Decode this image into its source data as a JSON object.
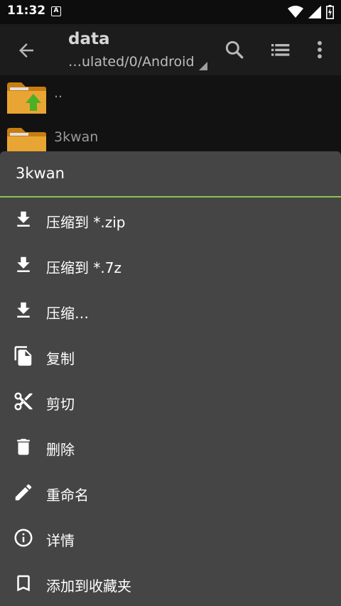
{
  "status_bar": {
    "time": "11:32",
    "notification_letter": "A"
  },
  "app_bar": {
    "title": "data",
    "subtitle": "…ulated/0/Android"
  },
  "files": [
    {
      "name": ".."
    },
    {
      "name": "3kwan"
    }
  ],
  "context_menu": {
    "title": "3kwan",
    "accent_color": "#8bc34a",
    "items": [
      {
        "label": "压缩到 *.zip",
        "icon": "download-icon"
      },
      {
        "label": "压缩到 *.7z",
        "icon": "download-icon"
      },
      {
        "label": "压缩…",
        "icon": "download-icon"
      },
      {
        "label": "复制",
        "icon": "copy-icon"
      },
      {
        "label": "剪切",
        "icon": "scissors-icon"
      },
      {
        "label": "删除",
        "icon": "trash-icon"
      },
      {
        "label": "重命名",
        "icon": "pencil-icon"
      },
      {
        "label": "详情",
        "icon": "info-icon"
      },
      {
        "label": "添加到收藏夹",
        "icon": "bookmark-icon"
      }
    ]
  }
}
